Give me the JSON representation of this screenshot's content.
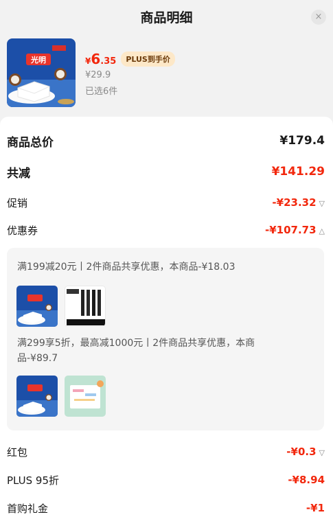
{
  "header": {
    "title": "商品明细",
    "close_glyph": "×"
  },
  "product": {
    "price_currency": "¥",
    "price_integer": "6",
    "price_decimal": ".35",
    "plus_tag": "PLUS到手价",
    "original_price": "¥29.9",
    "selected_count": "已选6件",
    "brand_text": "光明"
  },
  "summary": {
    "total_label": "商品总价",
    "total_value": "¥179.4",
    "discount_label": "共减",
    "discount_value": "¥141.29",
    "promo_label": "促销",
    "promo_value": "-¥23.32",
    "coupon_label": "优惠券",
    "coupon_value": "-¥107.73"
  },
  "coupons": [
    {
      "text": "满199减20元丨2件商品共享优惠，本商品-¥18.03"
    },
    {
      "text_line1": "满299享5折，最高减1000元丨2件商品共享优惠，本商",
      "text_line2": "品-¥89.7"
    }
  ],
  "extras": {
    "redpacket_label": "红包",
    "redpacket_value": "-¥0.3",
    "plus_label": "PLUS 95折",
    "plus_value": "-¥8.94",
    "firstbuy_label": "首购礼金",
    "firstbuy_value": "-¥1"
  },
  "icons": {
    "chevron_down": "chevron-down-icon",
    "chevron_up": "chevron-up-icon",
    "close": "close-icon"
  },
  "colors": {
    "accent_red": "#f2270c",
    "plus_tag_bg": "#fde8c8",
    "plus_tag_text": "#6b3a0a"
  }
}
